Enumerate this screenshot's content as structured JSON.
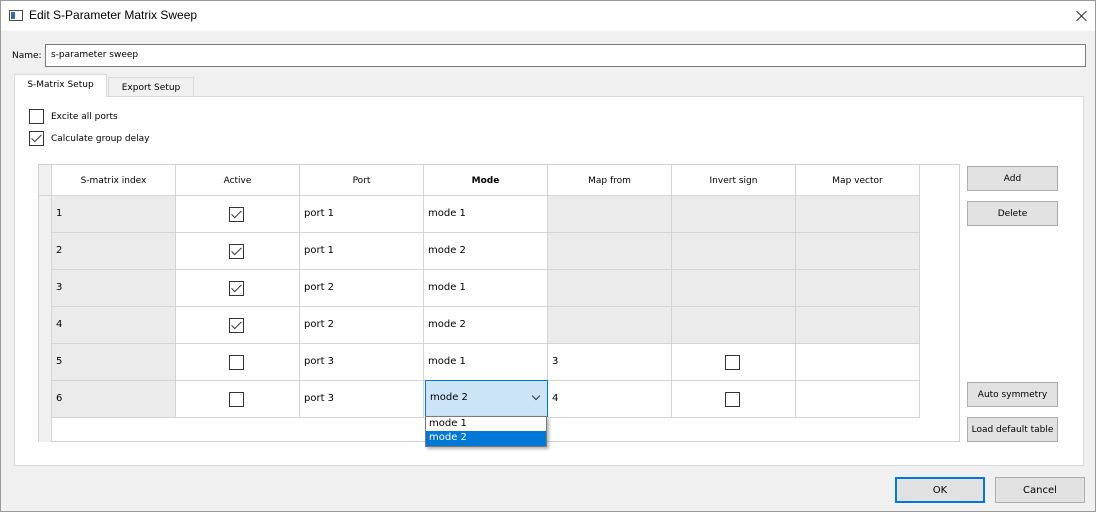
{
  "window": {
    "title": "Edit S-Parameter Matrix Sweep"
  },
  "name": {
    "label": "Name:",
    "value": "s-parameter sweep"
  },
  "tabs": [
    {
      "label": "S-Matrix Setup",
      "active": true
    },
    {
      "label": "Export Setup",
      "active": false
    }
  ],
  "options": {
    "excite_all_ports": {
      "label": "Excite all ports",
      "checked": false
    },
    "group_delay": {
      "label": "Calculate group delay",
      "checked": true
    }
  },
  "table": {
    "columns": [
      "S-matrix index",
      "Active",
      "Port",
      "Mode",
      "Map from",
      "Invert sign",
      "Map vector"
    ],
    "rows": [
      {
        "index": "1",
        "active": true,
        "port": "port 1",
        "mode": "mode 1",
        "map_from": "",
        "invert": null,
        "map_vector": ""
      },
      {
        "index": "2",
        "active": true,
        "port": "port 1",
        "mode": "mode 2",
        "map_from": "",
        "invert": null,
        "map_vector": ""
      },
      {
        "index": "3",
        "active": true,
        "port": "port 2",
        "mode": "mode 1",
        "map_from": "",
        "invert": null,
        "map_vector": ""
      },
      {
        "index": "4",
        "active": true,
        "port": "port 2",
        "mode": "mode 2",
        "map_from": "",
        "invert": null,
        "map_vector": ""
      },
      {
        "index": "5",
        "active": false,
        "port": "port 3",
        "mode": "mode 1",
        "map_from": "3",
        "invert": false,
        "map_vector": ""
      },
      {
        "index": "6",
        "active": false,
        "port": "port 3",
        "mode": "mode 2",
        "map_from": "4",
        "invert": false,
        "map_vector": ""
      }
    ]
  },
  "mode_dropdown": {
    "selected": "mode 2",
    "options": [
      "mode 1",
      "mode 2"
    ]
  },
  "side_buttons": {
    "add": "Add",
    "delete": "Delete",
    "auto_symmetry": "Auto symmetry",
    "load_default": "Load default table"
  },
  "footer": {
    "ok": "OK",
    "cancel": "Cancel"
  },
  "colors": {
    "accent": "#0078d7",
    "selection": "#cce4f7",
    "disabled_cell": "#ebebeb"
  }
}
